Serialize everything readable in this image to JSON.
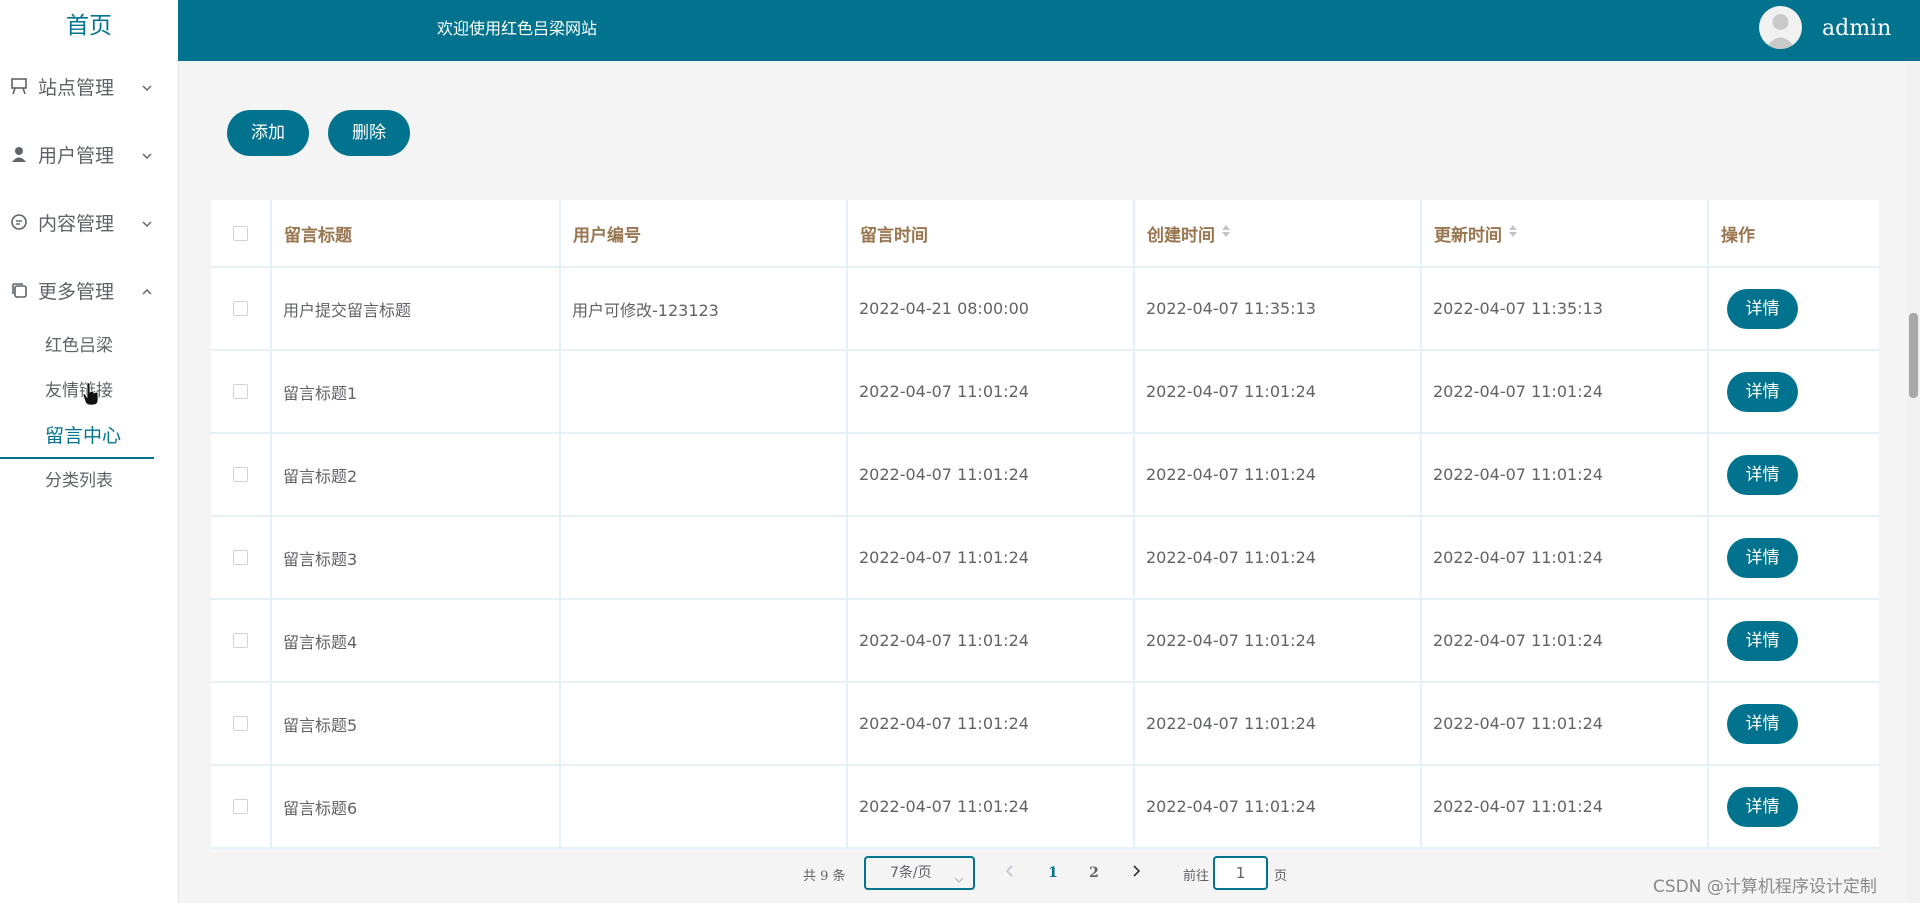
{
  "sidebar": {
    "brand": "首页",
    "menus": [
      {
        "label": "站点管理",
        "icon": "easel-icon",
        "expanded": false
      },
      {
        "label": "用户管理",
        "icon": "user-icon",
        "expanded": false
      },
      {
        "label": "内容管理",
        "icon": "chat-icon",
        "expanded": false
      },
      {
        "label": "更多管理",
        "icon": "copy-icon",
        "expanded": true
      }
    ],
    "submenu": [
      "红色吕梁",
      "友情链接",
      "留言中心",
      "分类列表"
    ],
    "active_submenu": "留言中心"
  },
  "header": {
    "welcome": "欢迎使用红色吕梁网站",
    "username": "admin",
    "accent": "#02738e"
  },
  "toolbar": {
    "add_label": "添加",
    "delete_label": "删除"
  },
  "table": {
    "columns": [
      "留言标题",
      "用户编号",
      "留言时间",
      "创建时间",
      "更新时间",
      "操作"
    ],
    "action_label": "详情",
    "rows": [
      [
        "用户提交留言标题",
        "用户可修改-123123",
        "2022-04-21 08:00:00",
        "2022-04-07 11:35:13",
        "2022-04-07 11:35:13"
      ],
      [
        "留言标题1",
        "",
        "2022-04-07 11:01:24",
        "2022-04-07 11:01:24",
        "2022-04-07 11:01:24"
      ],
      [
        "留言标题2",
        "",
        "2022-04-07 11:01:24",
        "2022-04-07 11:01:24",
        "2022-04-07 11:01:24"
      ],
      [
        "留言标题3",
        "",
        "2022-04-07 11:01:24",
        "2022-04-07 11:01:24",
        "2022-04-07 11:01:24"
      ],
      [
        "留言标题4",
        "",
        "2022-04-07 11:01:24",
        "2022-04-07 11:01:24",
        "2022-04-07 11:01:24"
      ],
      [
        "留言标题5",
        "",
        "2022-04-07 11:01:24",
        "2022-04-07 11:01:24",
        "2022-04-07 11:01:24"
      ],
      [
        "留言标题6",
        "",
        "2022-04-07 11:01:24",
        "2022-04-07 11:01:24",
        "2022-04-07 11:01:24"
      ]
    ]
  },
  "pagination": {
    "total": "共 9 条",
    "page_size": "7条/页",
    "pages": [
      "1",
      "2"
    ],
    "current": "1",
    "goto_label": "前往",
    "goto_value": "1",
    "page_unit": "页"
  },
  "watermark": "CSDN @计算机程序设计定制"
}
